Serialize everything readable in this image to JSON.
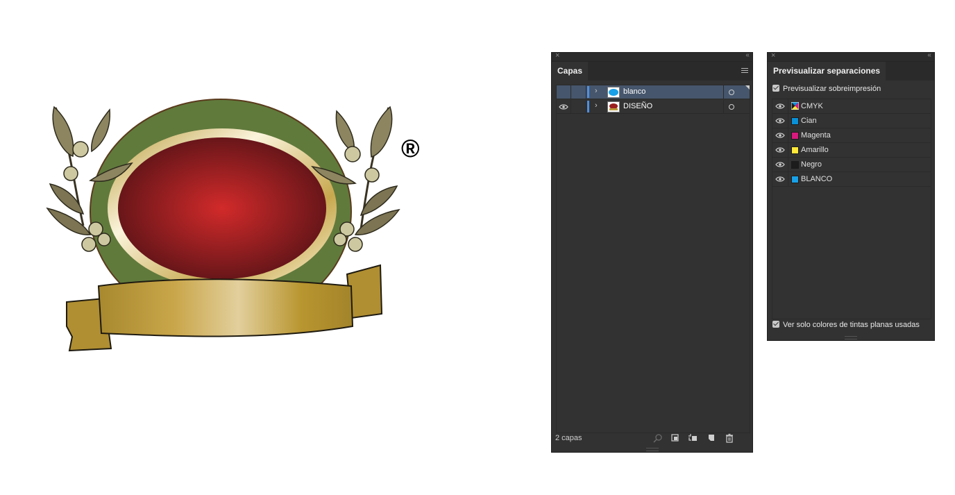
{
  "canvas": {
    "registered_mark": "®"
  },
  "layers_panel": {
    "tab_label": "Capas",
    "close_glyph": "×",
    "collapse_glyph": "‹‹",
    "layers": [
      {
        "name": "blanco",
        "visible": false,
        "selected": true,
        "color": "#4d8fe0"
      },
      {
        "name": "DISEÑO",
        "visible": true,
        "selected": false,
        "color": "#4d8fe0"
      }
    ],
    "layer_count": "2 capas",
    "footer_icons": [
      "search-icon",
      "clipping-mask-icon",
      "new-sublayer-icon",
      "new-layer-icon",
      "trash-icon"
    ]
  },
  "separations_panel": {
    "tab_label": "Previsualizar separaciones",
    "close_glyph": "×",
    "collapse_glyph": "‹‹",
    "overprint_preview_label": "Previsualizar sobreimpresión",
    "overprint_checked": true,
    "separations": [
      {
        "name": "CMYK",
        "swatch": "cmyk"
      },
      {
        "name": "Cian",
        "swatch": "#0a90d6"
      },
      {
        "name": "Magenta",
        "swatch": "#d8197d"
      },
      {
        "name": "Amarillo",
        "swatch": "#ffe83a"
      },
      {
        "name": "Negro",
        "swatch": "#1c1c1c"
      },
      {
        "name": "BLANCO",
        "swatch": "#1aa0e6"
      }
    ],
    "spot_only_label": "Ver solo colores de tintas planas usadas",
    "spot_only_checked": true
  },
  "colors": {
    "panel_bg": "#323232",
    "selected_row": "#46566c",
    "layer_accent": "#4d8fe0"
  }
}
